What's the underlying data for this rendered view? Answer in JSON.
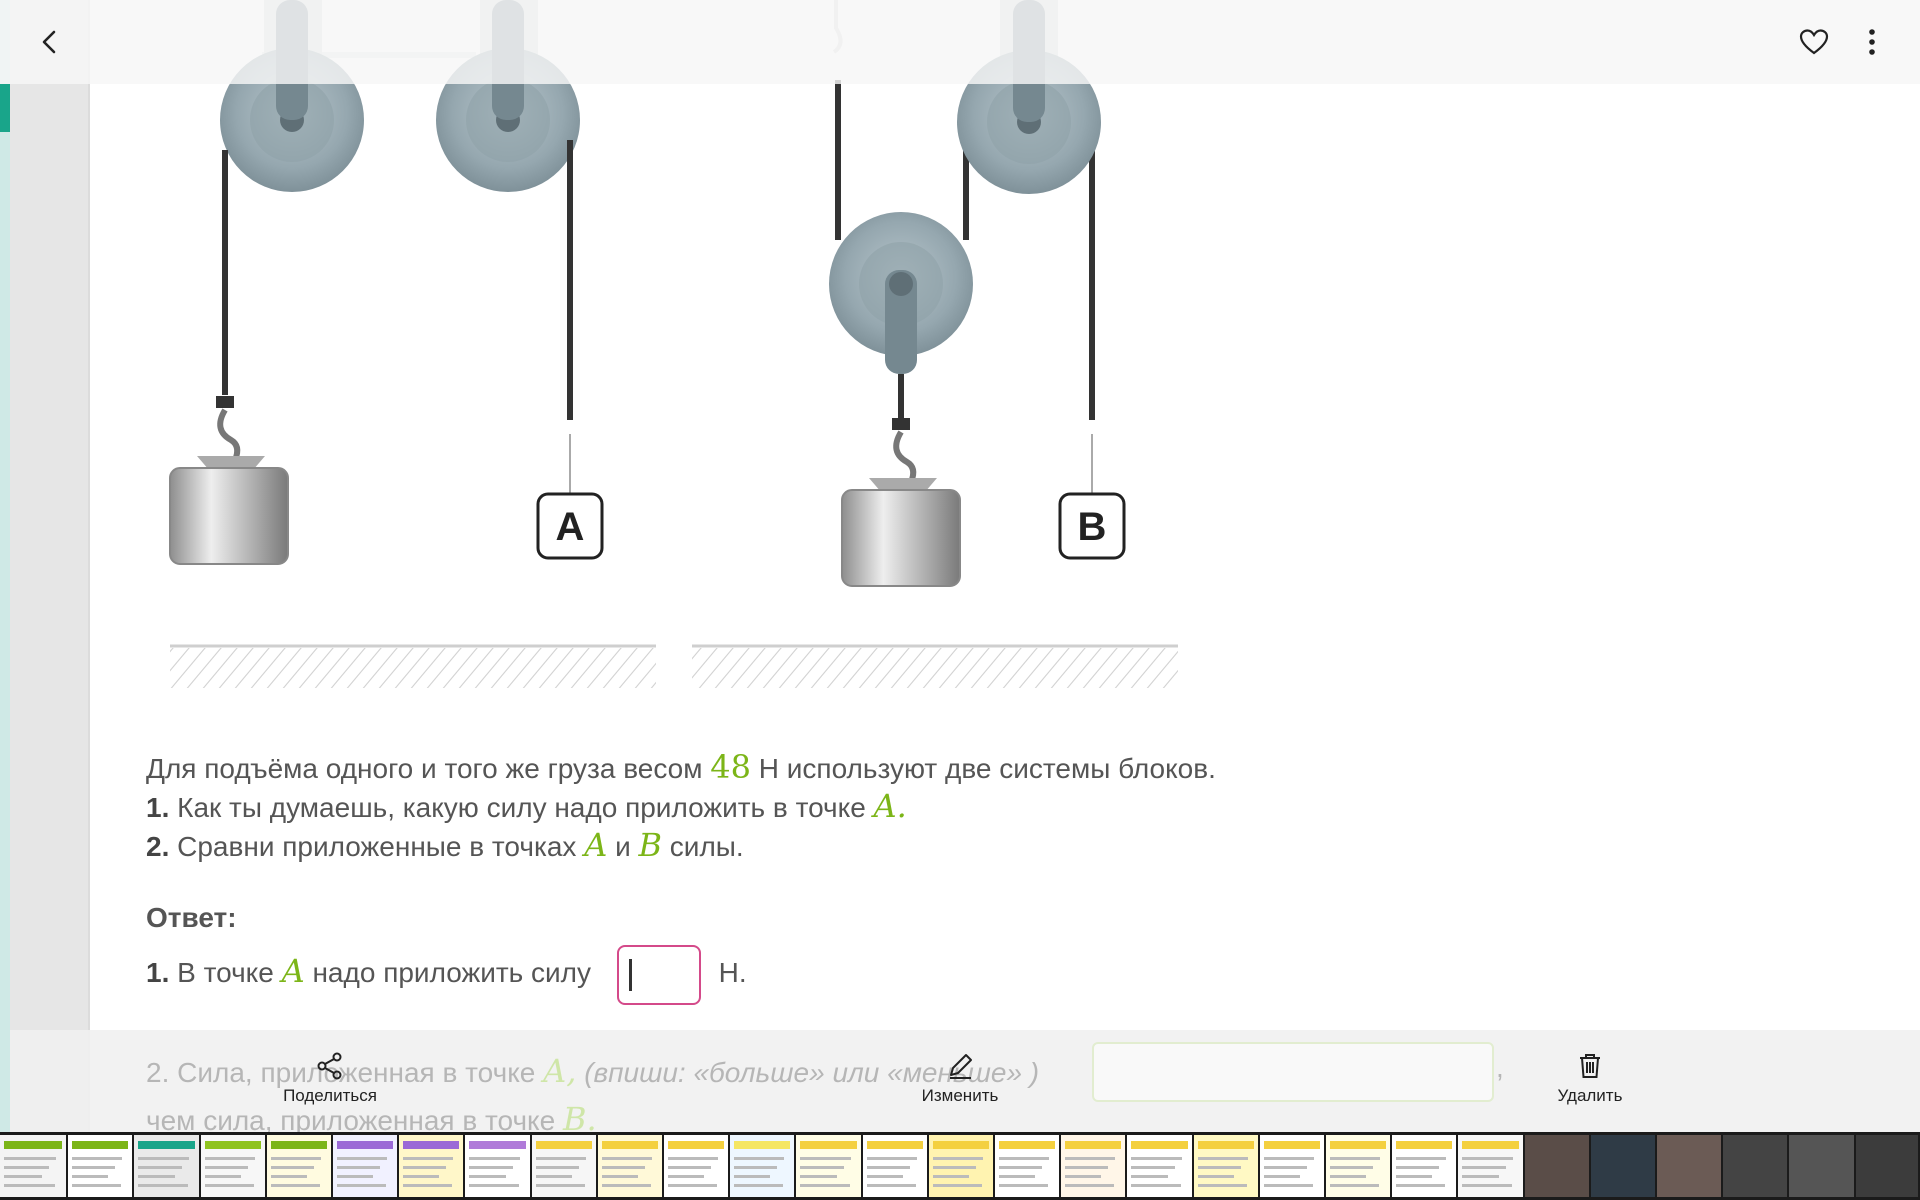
{
  "question": {
    "intro_before": "Для подъёма одного и того же груза весом",
    "weight": "48",
    "intro_after": "Н используют две системы блоков.",
    "q1_num": "1.",
    "q1_text": "Как ты думаешь, какую силу надо приложить в точке",
    "q1_point": "A.",
    "q2_num": "2.",
    "q2_text": "Сравни приложенные в точках",
    "q2_a": "A",
    "q2_and": "и",
    "q2_b": "B",
    "q2_end": "силы."
  },
  "figure": {
    "label_a": "A",
    "label_b": "B"
  },
  "answer": {
    "title": "Ответ:",
    "a1_num": "1.",
    "a1_before": "В точке",
    "a1_point": "A",
    "a1_after": "надо приложить силу",
    "a1_value": "",
    "a1_unit": "Н.",
    "a2_num": "2.",
    "a2_before": "Сила, приложенная в точке",
    "a2_point": "A,",
    "a2_hint": "(впиши: «больше» или «меньше» )",
    "a2_comma": ",",
    "a2_line2": "чем сила, приложенная в точке",
    "a2_point_b": "B."
  },
  "actions": {
    "share": "Поделиться",
    "edit": "Изменить",
    "delete": "Удалить"
  },
  "colors": {
    "accent_green": "#7cb518",
    "input_border": "#d44a8a",
    "side_accent": "#19a58a"
  },
  "icons": {
    "back": "chevron-left-icon",
    "favorite": "heart-icon",
    "menu": "more-vertical-icon",
    "share": "share-icon",
    "edit": "pencil-icon",
    "delete": "trash-icon"
  }
}
